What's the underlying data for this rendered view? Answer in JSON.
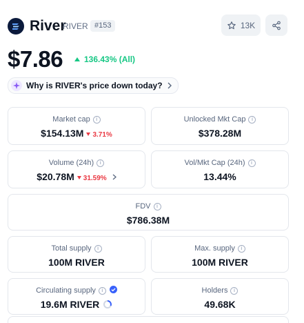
{
  "header": {
    "coin_name": "River",
    "symbol": "RIVER",
    "rank": "#153",
    "watchlist_count": "13K"
  },
  "price": {
    "value": "$7.86",
    "change": "136.43% (All)",
    "change_direction": "up",
    "up_color": "#16c784"
  },
  "why_button": "Why is RIVER's price down today?",
  "stats": {
    "market_cap": {
      "label": "Market cap",
      "value": "$154.13M",
      "change": "3.71%"
    },
    "unlocked_mkt_cap": {
      "label": "Unlocked Mkt Cap",
      "value": "$378.28M"
    },
    "volume": {
      "label": "Volume (24h)",
      "value": "$20.78M",
      "change": "31.59%"
    },
    "vol_mkt_cap": {
      "label": "Vol/Mkt Cap (24h)",
      "value": "13.44%"
    },
    "fdv": {
      "label": "FDV",
      "value": "$786.38M"
    },
    "total_supply": {
      "label": "Total supply",
      "value": "100M RIVER"
    },
    "max_supply": {
      "label": "Max. supply",
      "value": "100M RIVER"
    },
    "circulating_supply": {
      "label": "Circulating supply",
      "value": "19.6M RIVER"
    },
    "holders": {
      "label": "Holders",
      "value": "49.68K"
    }
  },
  "down_color": "#ea3943"
}
